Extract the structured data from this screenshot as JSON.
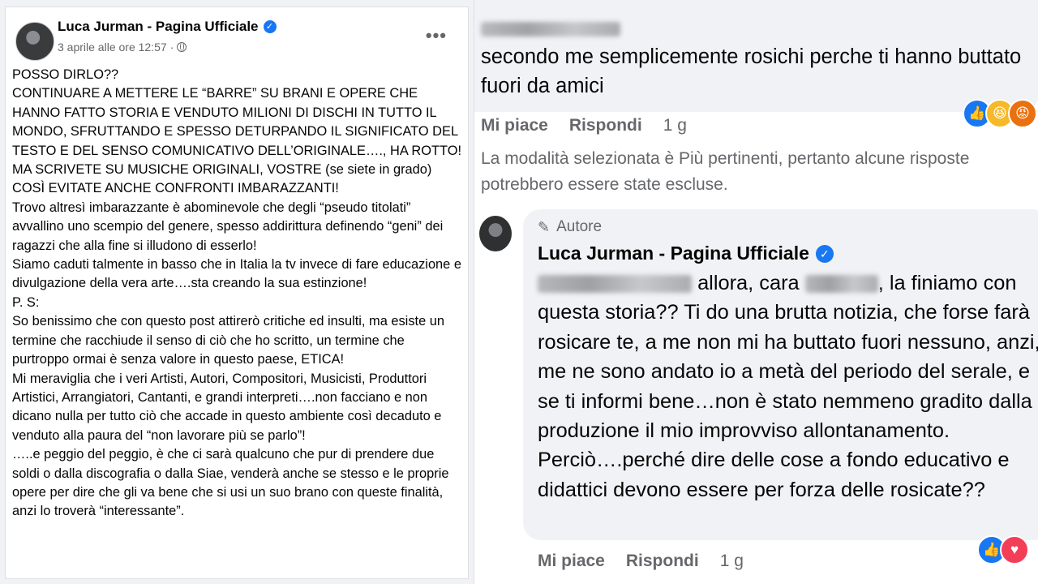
{
  "post": {
    "author": "Luca Jurman - Pagina Ufficiale",
    "timestamp": "3 aprile alle ore 12:57",
    "separator": "·",
    "more_label": "•••",
    "paragraphs": [
      "POSSO DIRLO??",
      "CONTINUARE A METTERE LE “BARRE” SU BRANI E OPERE CHE HANNO FATTO STORIA E VENDUTO MILIONI DI DISCHI IN TUTTO IL MONDO, SFRUTTANDO E SPESSO DETURPANDO IL SIGNIFICATO DEL TESTO E DEL SENSO COMUNICATIVO DELL’ORIGINALE…., HA ROTTO!",
      "MA SCRIVETE SU MUSICHE ORIGINALI, VOSTRE (se siete in grado) COSÌ EVITATE ANCHE CONFRONTI IMBARAZZANTI!",
      "Trovo altresì imbarazzante è abominevole che degli “pseudo titolati” avvallino uno scempio del genere, spesso addirittura definendo “geni” dei ragazzi che alla fine si illudono di esserlo!",
      "Siamo caduti talmente in basso che in Italia la tv invece di fare educazione e divulgazione della vera arte….sta creando la sua estinzione!",
      "P. S:",
      "So benissimo che con questo post attirerò critiche ed insulti, ma esiste un termine che racchiude il senso di ciò che ho scritto, un termine che purtroppo ormai è senza valore in questo paese, ETICA!",
      "Mi meraviglia che i veri Artisti, Autori, Compositori, Musicisti, Produttori Artistici, Arrangiatori, Cantanti, e grandi interpreti….non facciano e non dicano nulla per tutto ciò che accade in questo ambiente così decaduto e venduto alla paura del “non lavorare più se parlo”!",
      "…..e peggio del peggio, è che ci sarà qualcuno che pur di prendere due soldi o dalla discografia o dalla Siae, venderà anche se stesso e le proprie opere per dire che gli va bene che si usi un suo brano con queste finalità, anzi lo troverà “interessante”."
    ]
  },
  "comment": {
    "text": "secondo me semplicemente rosichi perche ti hanno buttato fuori da amici",
    "like_label": "Mi piace",
    "reply_label": "Rispondi",
    "time": "1 g",
    "reaction_icons": [
      "like-icon",
      "haha-icon",
      "angry-icon"
    ]
  },
  "notice": "La modalità selezionata è Più pertinenti, pertanto alcune risposte potrebbero essere state escluse.",
  "reply": {
    "badge": "Autore",
    "author": "Luca Jurman - Pagina Ufficiale",
    "text_part1": "allora, cara",
    "text_part2": ", la finiamo con questa storia?? Ti do una brutta notizia, che forse farà rosicare te, a me non mi ha buttato fuori nessuno, anzi, me ne sono andato io a metà del periodo del serale, e se ti informi bene…non è stato nemmeno gradito dalla produzione il mio improvviso allontanamento. Perciò….perché dire delle cose a fondo educativo e didattici devono essere per forza delle rosicate??",
    "like_label": "Mi piace",
    "reply_label": "Rispondi",
    "time": "1 g",
    "reaction_icons": [
      "like-icon",
      "love-icon"
    ]
  },
  "colors": {
    "verified": "#1877f2",
    "secondary_text": "#65676b",
    "bubble": "#f0f2f5"
  }
}
